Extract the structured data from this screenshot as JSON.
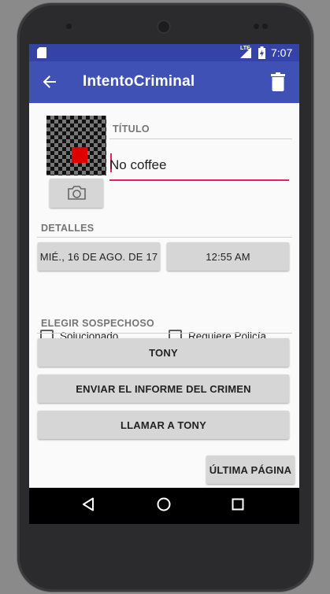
{
  "status_bar": {
    "network": "LTE",
    "time": "7:07"
  },
  "app_bar": {
    "title": "IntentoCriminal"
  },
  "crime": {
    "title_label": "TÍTULO",
    "title_value": "No coffee",
    "details_label": "DETALLES",
    "date_button": "MIÉ., 16 DE AGO. DE 17",
    "time_button": "12:55 AM",
    "solved_label": "Solucionado",
    "requires_police_label": "Requiere Policía",
    "suspect_label": "ELEGIR SOSPECHOSO",
    "suspect_button": "TONY",
    "report_button": "ENVIAR EL INFORME DEL CRIMEN",
    "call_button": "LLAMAR A TONY",
    "last_page_button": "ÚLTIMA PÁGINA"
  },
  "colors": {
    "primary": "#3f51b5",
    "primary_dark": "#3543a7",
    "accent": "#e91e63"
  }
}
